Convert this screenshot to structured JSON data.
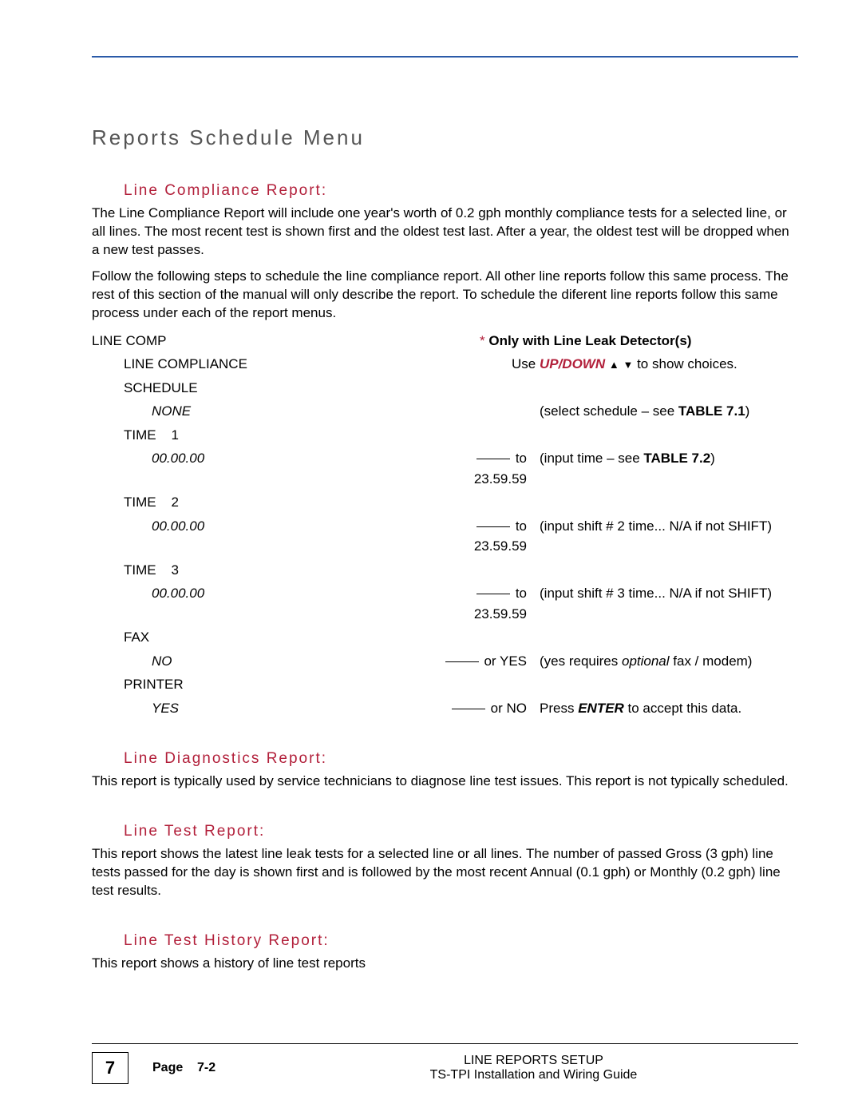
{
  "headings": {
    "section": "Reports Schedule Menu",
    "h_compliance": "Line Compliance Report:",
    "h_diag": "Line Diagnostics Report:",
    "h_test": "Line Test  Report:",
    "h_history": "Line Test History Report:"
  },
  "paragraphs": {
    "compliance_p1": "The Line Compliance Report will include one year's worth of 0.2 gph monthly compliance tests for a selected line, or all lines.  The most recent test is shown first and the oldest test last.  After a year, the oldest test will be dropped when a new test passes.",
    "compliance_p2": "Follow the following steps to schedule the line compliance report.  All other line reports follow this same process.  The rest of this section of the manual will only describe the report.  To schedule the diferent line reports follow this same process under each of the report menus.",
    "diag_p": "This report is typically used by service technicians to diagnose line test issues.  This report is not typically scheduled.",
    "test_p": "This report shows the latest line leak tests for a selected line or all lines. The number of passed Gross (3 gph) line tests passed for the day is shown first and is followed by the most recent Annual (0.1 gph) or Monthly (0.2 gph) line test results.",
    "history_p": "This report shows a history of line test reports"
  },
  "menu": {
    "root": "LINE COMP",
    "root_note_star": "*",
    "root_note": " Only with Line Leak Detector(s)",
    "lvl1": "LINE COMPLIANCE",
    "lvl1_note_pre": "Use ",
    "lvl1_note_updown": "UP/DOWN",
    "lvl1_note_post": " to show choices.",
    "schedule": "SCHEDULE",
    "schedule_val": "NONE",
    "schedule_hint_pre": "(select schedule – see ",
    "schedule_hint_bold": "TABLE 7.1",
    "schedule_hint_post": ")",
    "time1": "TIME    1",
    "time2": "TIME    2",
    "time3": "TIME    3",
    "time_val": "00.00.00",
    "time_alt": " to 23.59.59",
    "time1_hint_pre": "(input time – see ",
    "time1_hint_bold": "TABLE 7.2",
    "time1_hint_post": ")",
    "time2_hint": "(input shift # 2 time... N/A if not SHIFT)",
    "time3_hint": "(input shift # 3 time... N/A if not SHIFT)",
    "fax": "FAX",
    "fax_val": "NO",
    "fax_alt": " or YES",
    "fax_hint_pre": "(yes requires ",
    "fax_hint_italic": "optional",
    "fax_hint_post": " fax / modem)",
    "printer": "PRINTER",
    "printer_val": "YES",
    "printer_alt": " or NO",
    "printer_hint_pre": "Press ",
    "printer_hint_bold": "ENTER",
    "printer_hint_post": " to accept this data."
  },
  "footer": {
    "chapter": "7",
    "page_label": "Page    7-2",
    "line1": "LINE REPORTS SETUP",
    "line2": "TS-TPI Installation and Wiring Guide"
  }
}
